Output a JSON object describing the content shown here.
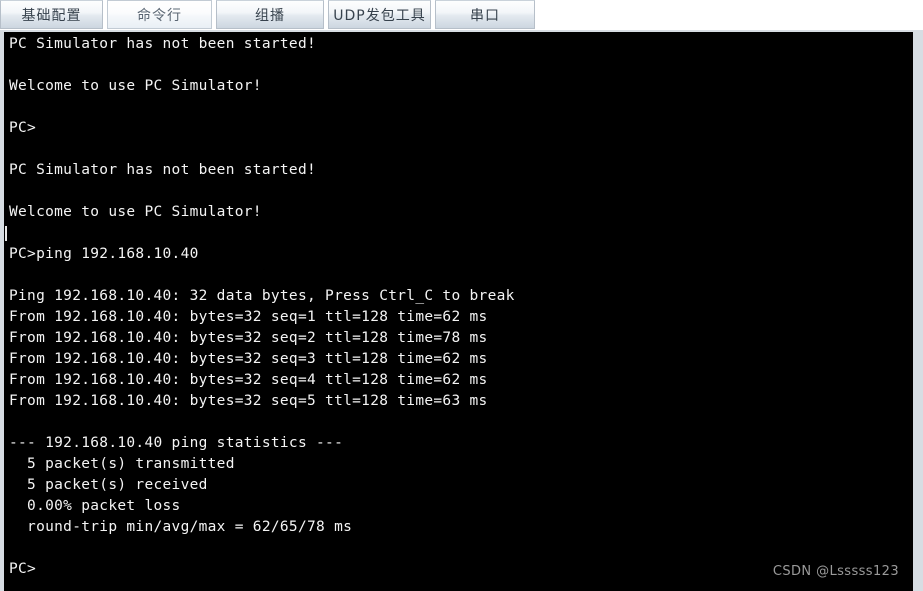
{
  "window": {
    "app_kind": "pc-simulator-terminal"
  },
  "tabs": {
    "items": [
      {
        "id": "basic-config",
        "label": "基础配置",
        "active": false
      },
      {
        "id": "command-line",
        "label": "命令行",
        "active": true
      },
      {
        "id": "multicast",
        "label": "组播",
        "active": false
      },
      {
        "id": "udp-packet-tool",
        "label": "UDP发包工具",
        "active": false
      },
      {
        "id": "serial-port",
        "label": "串口",
        "active": false
      }
    ]
  },
  "terminal": {
    "lines": [
      "PC Simulator has not been started!",
      "",
      "Welcome to use PC Simulator!",
      "",
      "PC>",
      "",
      "PC Simulator has not been started!",
      "",
      "Welcome to use PC Simulator!",
      "",
      "PC>ping 192.168.10.40",
      "",
      "Ping 192.168.10.40: 32 data bytes, Press Ctrl_C to break",
      "From 192.168.10.40: bytes=32 seq=1 ttl=128 time=62 ms",
      "From 192.168.10.40: bytes=32 seq=2 ttl=128 time=78 ms",
      "From 192.168.10.40: bytes=32 seq=3 ttl=128 time=62 ms",
      "From 192.168.10.40: bytes=32 seq=4 ttl=128 time=62 ms",
      "From 192.168.10.40: bytes=32 seq=5 ttl=128 time=63 ms",
      "",
      "--- 192.168.10.40 ping statistics ---",
      "  5 packet(s) transmitted",
      "  5 packet(s) received",
      "  0.00% packet loss",
      "  round-trip min/avg/max = 62/65/78 ms",
      "",
      "PC>"
    ],
    "caret_line_index": 10,
    "colors": {
      "background": "#000000",
      "text": "#f4f4f4"
    }
  },
  "watermark": {
    "text": "CSDN @Lsssss123",
    "color": "#9a9a9a"
  }
}
